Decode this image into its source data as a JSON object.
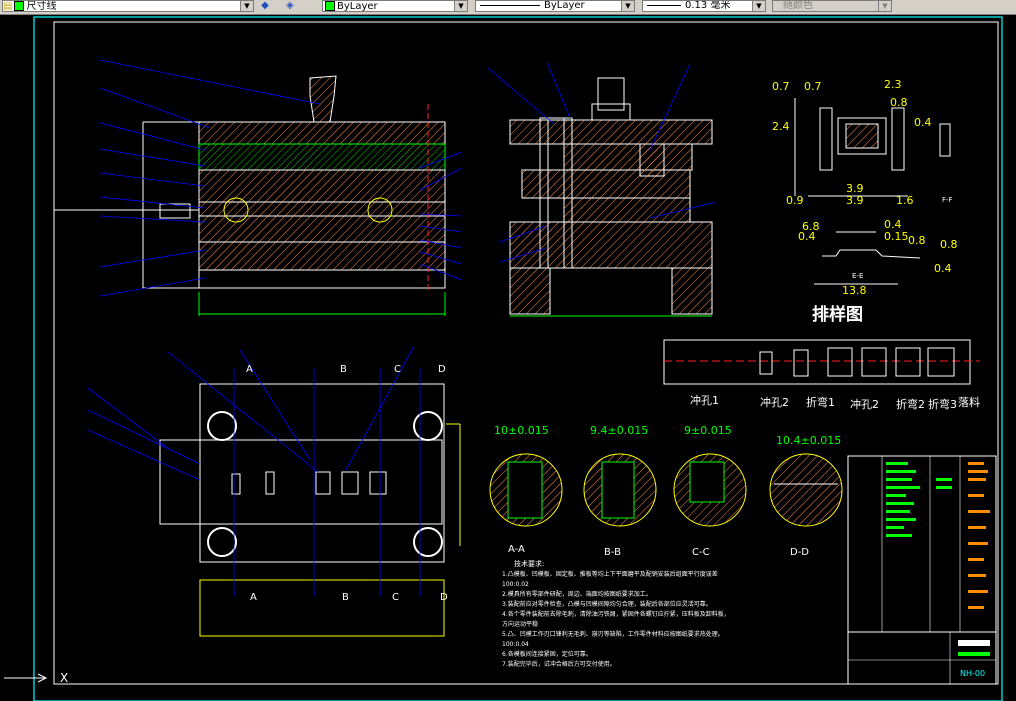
{
  "toolbar": {
    "dim_style": "尺寸线",
    "color": "ByLayer",
    "linetype": "ByLayer",
    "lineweight": "0.13 毫米",
    "plotstyle": "随颜色"
  },
  "dims": {
    "top_right": [
      "0.7",
      "0.7",
      "2.3",
      "0.8",
      "0.4",
      "2.4",
      "0.9",
      "3.9",
      "1.6",
      "3.9"
    ],
    "mid_right": [
      "6.8",
      "0.4",
      "0.15",
      "0.8",
      "0.8",
      "0.4",
      "13.8",
      "0.4"
    ],
    "section_ff": "F-F",
    "section_ee": "E-E"
  },
  "strip_title": "排样图",
  "strip_labels": [
    "冲孔1",
    "冲孔2",
    "折弯1",
    "冲孔2",
    "折弯2",
    "折弯3",
    "落料"
  ],
  "details": [
    {
      "dim": "10±0.015",
      "label": "A-A"
    },
    {
      "dim": "9.4±0.015",
      "label": "B-B"
    },
    {
      "dim": "9±0.015",
      "label": "C-C"
    },
    {
      "dim": "10.4±0.015",
      "label": "D-D"
    }
  ],
  "section_marks": [
    "A",
    "B",
    "C",
    "D"
  ],
  "tech": {
    "title": "技术要求:",
    "lines": [
      "1.凸模板、凹模板、固定板、推板等均上下平面磨平及配销安装后组面平行度误差",
      "100:0.02",
      "2.模具所有零部件研配，周边、端面均按图纸要求加工。",
      "3.装配前应对零件检查，凸模与凹模间隙均匀合理，装配后各部位应灵活可靠。",
      "4.各个零件装配前去除毛刺，清除油污铁屑，紧固件各螺钉应拧紧，压料板及卸料板，",
      "方向运动平稳",
      "5.凸、凹模工作刃口锋利无毛刺、崩刃等缺陷，工作零件材料应按图纸要求热处理。",
      "100:0.04",
      "6.各模板间连接紧固，定位可靠。",
      "7.装配完毕后，试冲合格后方可交付使用。"
    ]
  },
  "title_block": {
    "drawing_no": "NH-00"
  },
  "ucs": {
    "x": "X"
  }
}
